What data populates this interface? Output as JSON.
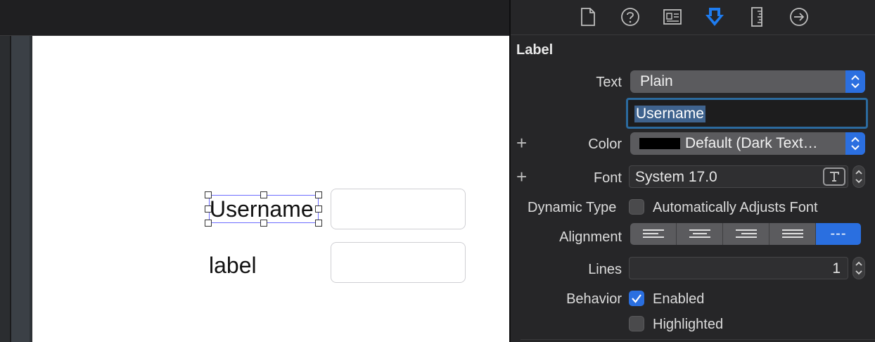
{
  "canvas": {
    "username_label_text": "Username",
    "second_label_text": "label"
  },
  "inspector": {
    "tabs": [
      {
        "name": "file-inspector",
        "icon": "document-icon"
      },
      {
        "name": "quick-help",
        "icon": "question-circle-icon"
      },
      {
        "name": "identity-inspector",
        "icon": "identity-card-icon"
      },
      {
        "name": "attributes-inspector",
        "icon": "attributes-icon",
        "selected": true
      },
      {
        "name": "size-inspector",
        "icon": "ruler-icon"
      },
      {
        "name": "connections-inspector",
        "icon": "arrow-circle-icon"
      }
    ],
    "section_title": "Label",
    "text": {
      "label": "Text",
      "type_value": "Plain",
      "content_value": "Username"
    },
    "color": {
      "label": "Color",
      "value": "Default (Dark Text…",
      "swatch": "#000000"
    },
    "font": {
      "label": "Font",
      "value": "System 17.0"
    },
    "dynamic_type": {
      "label": "Dynamic Type",
      "checkbox_label": "Automatically Adjusts Font",
      "checked": false
    },
    "alignment": {
      "label": "Alignment",
      "options": [
        "left",
        "center",
        "right",
        "justified",
        "natural"
      ],
      "selected": "natural",
      "natural_glyph": "---"
    },
    "lines": {
      "label": "Lines",
      "value": "1"
    },
    "behavior": {
      "label": "Behavior",
      "enabled_label": "Enabled",
      "enabled_checked": true,
      "highlighted_label": "Highlighted",
      "highlighted_checked": false
    }
  },
  "colors": {
    "accent": "#2a6fe0",
    "selection_outline": "#6d6dff",
    "inspector_bg": "#262628"
  }
}
